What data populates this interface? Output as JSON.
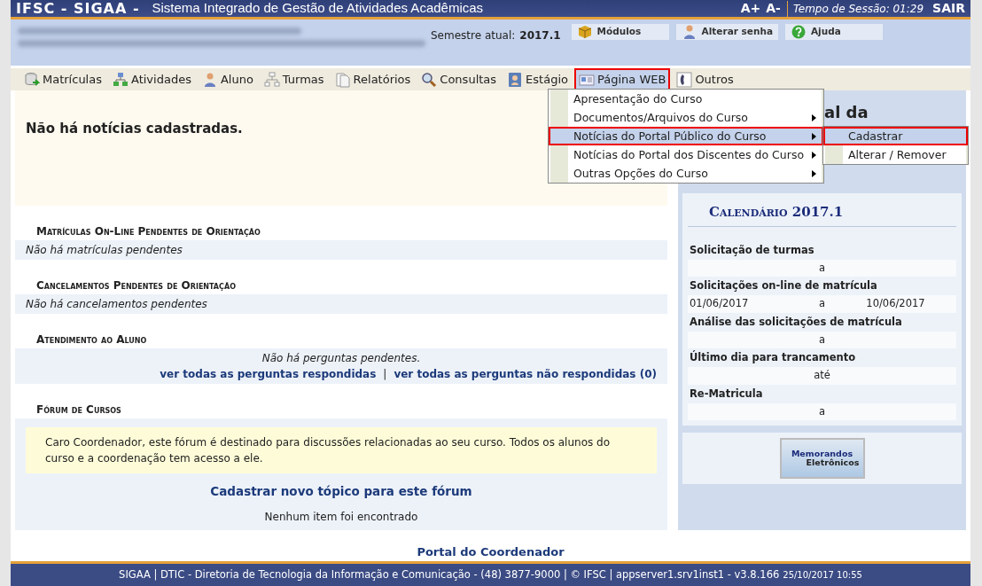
{
  "header": {
    "system": "IFSC - SIGAA -",
    "title": "Sistema Integrado de Gestão de Atividades Acadêmicas",
    "font_up": "A+",
    "font_down": "A-",
    "session_label": "Tempo de Sessão:",
    "session_time": "01:29",
    "logout": "SAIR"
  },
  "info": {
    "semester_label": "Semestre atual:",
    "semester": "2017.1",
    "buttons": [
      {
        "label": "Módulos"
      },
      {
        "label": "Alterar senha"
      },
      {
        "label": "Ajuda"
      }
    ]
  },
  "menu": [
    {
      "label": "Matrículas",
      "selected": false
    },
    {
      "label": "Atividades",
      "selected": false
    },
    {
      "label": "Aluno",
      "selected": false
    },
    {
      "label": "Turmas",
      "selected": false
    },
    {
      "label": "Relatórios",
      "selected": false
    },
    {
      "label": "Consultas",
      "selected": false
    },
    {
      "label": "Estágio",
      "selected": false
    },
    {
      "label": "Página WEB",
      "selected": true
    },
    {
      "label": "Outros",
      "selected": false
    }
  ],
  "dropdown": [
    {
      "label": "Apresentação do Curso",
      "submenu": false,
      "selected": false
    },
    {
      "label": "Documentos/Arquivos do Curso",
      "submenu": true,
      "selected": false
    },
    {
      "label": "Notícias do Portal Público do Curso",
      "submenu": true,
      "selected": true
    },
    {
      "label": "Notícias do Portal dos Discentes do Curso",
      "submenu": true,
      "selected": false
    },
    {
      "label": "Outras Opções do Curso",
      "submenu": true,
      "selected": false
    }
  ],
  "submenu": [
    {
      "label": "Cadastrar",
      "selected": true
    },
    {
      "label": "Alterar / Remover",
      "selected": false
    }
  ],
  "news_message": "Não há notícias cadastradas.",
  "sections": [
    {
      "title": "Matrículas On-Line Pendentes de Orientação",
      "kind": "empty",
      "message": "Não há matrículas pendentes"
    },
    {
      "title": "Cancelamentos Pendentes de Orientação",
      "kind": "empty",
      "message": "Não há cancelamentos pendentes"
    },
    {
      "title": "Atendimento ao Aluno",
      "kind": "questions",
      "message": "Não há perguntas pendentes.",
      "links": [
        "ver todas as perguntas respondidas",
        "ver todas as perguntas não respondidas (0)"
      ],
      "separator": "|"
    },
    {
      "title": "Fórum de Cursos",
      "kind": "forum",
      "notice": "Caro Coordenador, este fórum é destinado para discussões relacionadas ao seu curso. Todos os alunos do curso e a coordenação tem acesso a ele.",
      "link": "Cadastrar novo tópico para este fórum",
      "message": "Nenhum item foi encontrado"
    }
  ],
  "portal_heading": "al da",
  "calendar": {
    "title": "Calendário 2017.1",
    "rows": [
      {
        "label": "Solicitação de turmas",
        "start": "",
        "separator": "a",
        "end": ""
      },
      {
        "label": "Solicitações on-line de matrícula",
        "start": "01/06/2017",
        "separator": "a",
        "end": "10/06/2017"
      },
      {
        "label": "Análise das solicitações de matrícula",
        "start": "",
        "separator": "a",
        "end": ""
      },
      {
        "label": "Último dia para trancamento",
        "start": "",
        "separator": "até",
        "end": ""
      },
      {
        "label": "Re-Matricula",
        "start": "",
        "separator": "a",
        "end": ""
      }
    ]
  },
  "memorandos": {
    "line1": "Memorandos",
    "line2": "Eletrônicos"
  },
  "footer": {
    "portal": "Portal do Coordenador",
    "text": "SIGAA | DTIC - Diretoria de Tecnologia da Informação e Comunicação - (48) 3877-9000 | © IFSC | appserver1.srv1inst1 - v3.8.166",
    "timestamp": "25/10/2017 10:55"
  }
}
